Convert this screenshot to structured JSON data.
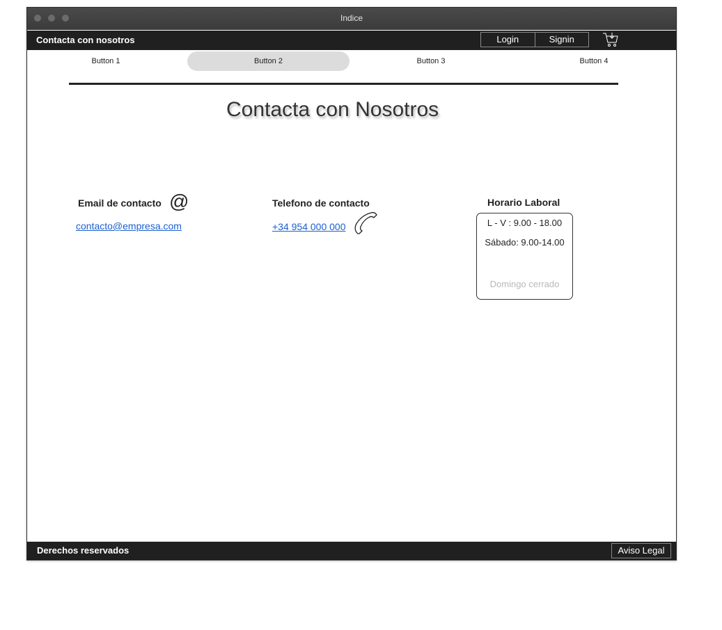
{
  "window": {
    "title": "Indice"
  },
  "header": {
    "brand": "Contacta con nosotros",
    "login_label": "Login",
    "signin_label": "Signin",
    "cart_icon": "cart-icon"
  },
  "nav": {
    "items": [
      {
        "label": "Button 1"
      },
      {
        "label": "Button 2"
      },
      {
        "label": "Button 3"
      },
      {
        "label": "Button 4"
      }
    ],
    "active_index": 1
  },
  "page": {
    "title": "Contacta con Nosotros"
  },
  "email": {
    "label": "Email de contacto",
    "icon": "@",
    "value": "contacto@empresa.com"
  },
  "phone": {
    "label": "Telefono de contacto",
    "value": "+34 954 000 000",
    "icon": "phone-icon"
  },
  "hours": {
    "title": "Horario Laboral",
    "lines": [
      "L - V : 9.00 - 18.00",
      "Sábado: 9.00-14.00",
      "Domingo cerrado"
    ]
  },
  "footer": {
    "copyright": "Derechos reservados",
    "legal_label": "Aviso Legal"
  }
}
